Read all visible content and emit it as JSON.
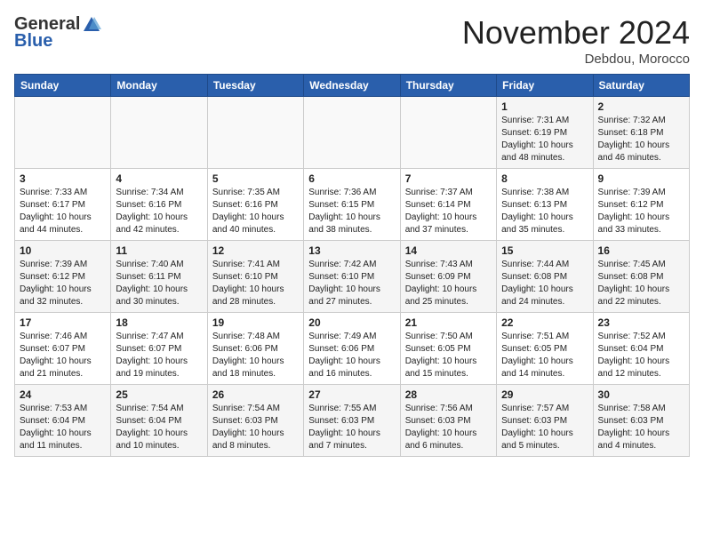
{
  "header": {
    "logo_general": "General",
    "logo_blue": "Blue",
    "month_title": "November 2024",
    "location": "Debdou, Morocco"
  },
  "weekdays": [
    "Sunday",
    "Monday",
    "Tuesday",
    "Wednesday",
    "Thursday",
    "Friday",
    "Saturday"
  ],
  "weeks": [
    [
      {
        "day": "",
        "info": ""
      },
      {
        "day": "",
        "info": ""
      },
      {
        "day": "",
        "info": ""
      },
      {
        "day": "",
        "info": ""
      },
      {
        "day": "",
        "info": ""
      },
      {
        "day": "1",
        "info": "Sunrise: 7:31 AM\nSunset: 6:19 PM\nDaylight: 10 hours and 48 minutes."
      },
      {
        "day": "2",
        "info": "Sunrise: 7:32 AM\nSunset: 6:18 PM\nDaylight: 10 hours and 46 minutes."
      }
    ],
    [
      {
        "day": "3",
        "info": "Sunrise: 7:33 AM\nSunset: 6:17 PM\nDaylight: 10 hours and 44 minutes."
      },
      {
        "day": "4",
        "info": "Sunrise: 7:34 AM\nSunset: 6:16 PM\nDaylight: 10 hours and 42 minutes."
      },
      {
        "day": "5",
        "info": "Sunrise: 7:35 AM\nSunset: 6:16 PM\nDaylight: 10 hours and 40 minutes."
      },
      {
        "day": "6",
        "info": "Sunrise: 7:36 AM\nSunset: 6:15 PM\nDaylight: 10 hours and 38 minutes."
      },
      {
        "day": "7",
        "info": "Sunrise: 7:37 AM\nSunset: 6:14 PM\nDaylight: 10 hours and 37 minutes."
      },
      {
        "day": "8",
        "info": "Sunrise: 7:38 AM\nSunset: 6:13 PM\nDaylight: 10 hours and 35 minutes."
      },
      {
        "day": "9",
        "info": "Sunrise: 7:39 AM\nSunset: 6:12 PM\nDaylight: 10 hours and 33 minutes."
      }
    ],
    [
      {
        "day": "10",
        "info": "Sunrise: 7:39 AM\nSunset: 6:12 PM\nDaylight: 10 hours and 32 minutes."
      },
      {
        "day": "11",
        "info": "Sunrise: 7:40 AM\nSunset: 6:11 PM\nDaylight: 10 hours and 30 minutes."
      },
      {
        "day": "12",
        "info": "Sunrise: 7:41 AM\nSunset: 6:10 PM\nDaylight: 10 hours and 28 minutes."
      },
      {
        "day": "13",
        "info": "Sunrise: 7:42 AM\nSunset: 6:10 PM\nDaylight: 10 hours and 27 minutes."
      },
      {
        "day": "14",
        "info": "Sunrise: 7:43 AM\nSunset: 6:09 PM\nDaylight: 10 hours and 25 minutes."
      },
      {
        "day": "15",
        "info": "Sunrise: 7:44 AM\nSunset: 6:08 PM\nDaylight: 10 hours and 24 minutes."
      },
      {
        "day": "16",
        "info": "Sunrise: 7:45 AM\nSunset: 6:08 PM\nDaylight: 10 hours and 22 minutes."
      }
    ],
    [
      {
        "day": "17",
        "info": "Sunrise: 7:46 AM\nSunset: 6:07 PM\nDaylight: 10 hours and 21 minutes."
      },
      {
        "day": "18",
        "info": "Sunrise: 7:47 AM\nSunset: 6:07 PM\nDaylight: 10 hours and 19 minutes."
      },
      {
        "day": "19",
        "info": "Sunrise: 7:48 AM\nSunset: 6:06 PM\nDaylight: 10 hours and 18 minutes."
      },
      {
        "day": "20",
        "info": "Sunrise: 7:49 AM\nSunset: 6:06 PM\nDaylight: 10 hours and 16 minutes."
      },
      {
        "day": "21",
        "info": "Sunrise: 7:50 AM\nSunset: 6:05 PM\nDaylight: 10 hours and 15 minutes."
      },
      {
        "day": "22",
        "info": "Sunrise: 7:51 AM\nSunset: 6:05 PM\nDaylight: 10 hours and 14 minutes."
      },
      {
        "day": "23",
        "info": "Sunrise: 7:52 AM\nSunset: 6:04 PM\nDaylight: 10 hours and 12 minutes."
      }
    ],
    [
      {
        "day": "24",
        "info": "Sunrise: 7:53 AM\nSunset: 6:04 PM\nDaylight: 10 hours and 11 minutes."
      },
      {
        "day": "25",
        "info": "Sunrise: 7:54 AM\nSunset: 6:04 PM\nDaylight: 10 hours and 10 minutes."
      },
      {
        "day": "26",
        "info": "Sunrise: 7:54 AM\nSunset: 6:03 PM\nDaylight: 10 hours and 8 minutes."
      },
      {
        "day": "27",
        "info": "Sunrise: 7:55 AM\nSunset: 6:03 PM\nDaylight: 10 hours and 7 minutes."
      },
      {
        "day": "28",
        "info": "Sunrise: 7:56 AM\nSunset: 6:03 PM\nDaylight: 10 hours and 6 minutes."
      },
      {
        "day": "29",
        "info": "Sunrise: 7:57 AM\nSunset: 6:03 PM\nDaylight: 10 hours and 5 minutes."
      },
      {
        "day": "30",
        "info": "Sunrise: 7:58 AM\nSunset: 6:03 PM\nDaylight: 10 hours and 4 minutes."
      }
    ]
  ]
}
